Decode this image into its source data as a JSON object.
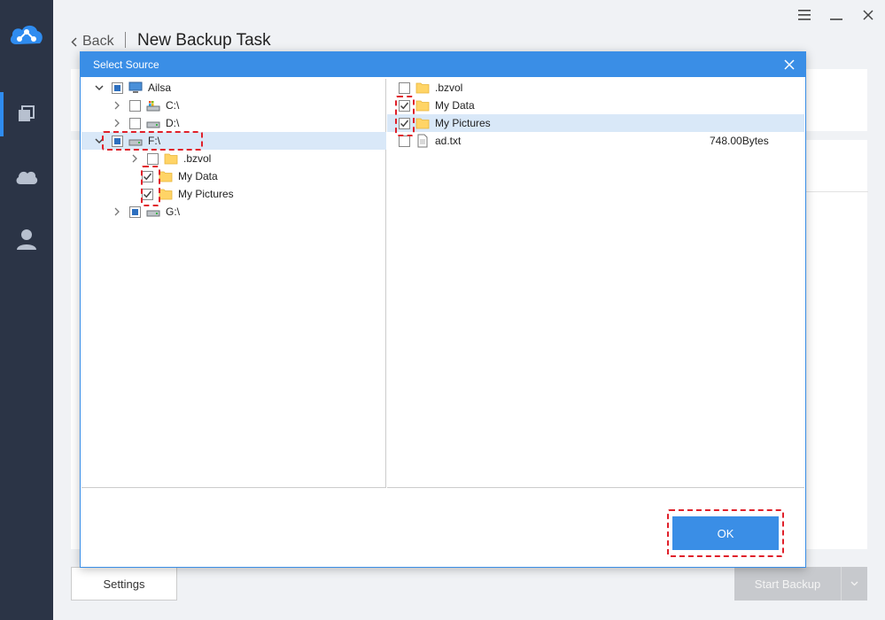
{
  "header": {
    "back_label": "Back",
    "page_title": "New Backup Task"
  },
  "footer": {
    "settings_label": "Settings",
    "start_backup_label": "Start Backup"
  },
  "dialog": {
    "title": "Select Source",
    "ok_label": "OK",
    "tree": [
      {
        "label": "Ailsa",
        "expander": "expanded",
        "check": "partial",
        "icon": "computer-icon"
      },
      {
        "label": "C:\\",
        "expander": "collapsed",
        "check": "unchecked",
        "icon": "system-drive-icon"
      },
      {
        "label": "D:\\",
        "expander": "collapsed",
        "check": "unchecked",
        "icon": "drive-icon"
      },
      {
        "label": "F:\\",
        "expander": "expanded",
        "check": "partial",
        "icon": "drive-icon",
        "selected": true
      },
      {
        "label": ".bzvol",
        "expander": "collapsed",
        "check": "unchecked",
        "icon": "folder-icon"
      },
      {
        "label": "My Data",
        "expander": "none",
        "check": "checked",
        "icon": "folder-icon"
      },
      {
        "label": "My Pictures",
        "expander": "none",
        "check": "checked",
        "icon": "folder-icon"
      },
      {
        "label": "G:\\",
        "expander": "collapsed",
        "check": "partial",
        "icon": "drive-icon"
      }
    ],
    "list": [
      {
        "label": ".bzvol",
        "check": "unchecked",
        "icon": "folder-icon",
        "size": ""
      },
      {
        "label": "My Data",
        "check": "checked",
        "icon": "folder-icon",
        "size": ""
      },
      {
        "label": "My Pictures",
        "check": "checked",
        "icon": "folder-icon",
        "size": "",
        "selected": true
      },
      {
        "label": "ad.txt",
        "check": "unchecked",
        "icon": "text-file-icon",
        "size": "748.00Bytes"
      }
    ]
  },
  "colors": {
    "sidebar_bg": "#2b3446",
    "accent": "#3a8ee6",
    "highlight": "#e0202a",
    "folder": "#ffd466"
  }
}
